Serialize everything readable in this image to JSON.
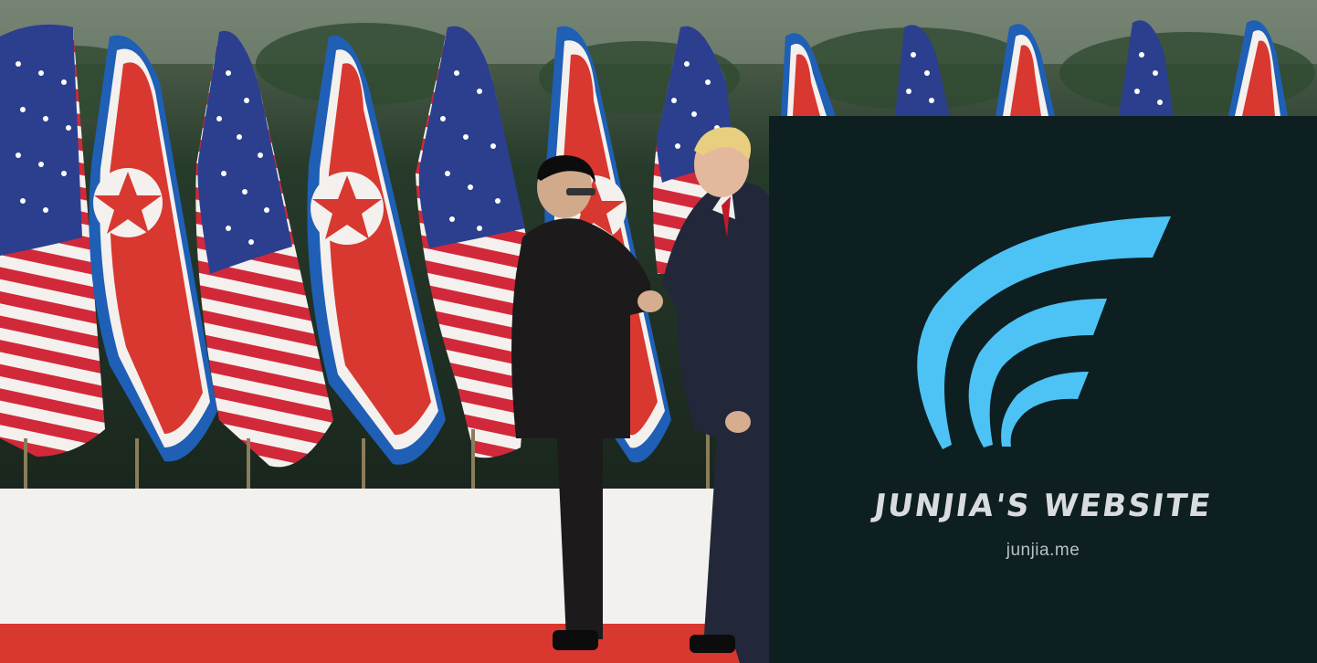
{
  "brand": {
    "title": "JUNJIA'S WEBSITE",
    "url": "junjia.me",
    "logo_icon": "signal-arcs-icon",
    "logo_color": "#4dc2f5",
    "background": "#0e1f21"
  },
  "photo": {
    "flags": [
      "us-flag-icon",
      "nk-flag-icon",
      "us-flag-icon",
      "nk-flag-icon",
      "us-flag-icon",
      "nk-flag-icon",
      "us-flag-icon",
      "nk-flag-icon",
      "us-flag-icon",
      "us-flag-icon",
      "nk-flag-icon"
    ],
    "stage_color": "#f3f1ee",
    "carpet_color": "#d8382f"
  }
}
